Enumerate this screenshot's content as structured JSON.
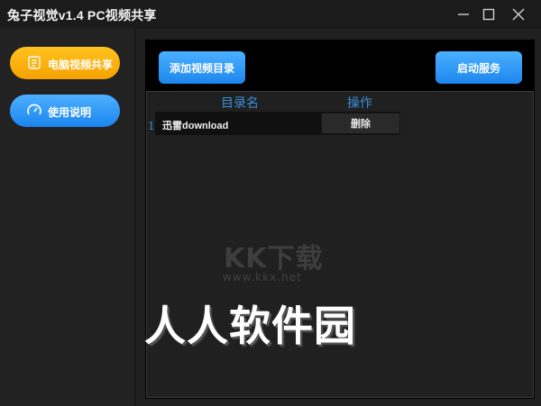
{
  "window": {
    "title": "兔子视觉v1.4 PC视频共享",
    "controls": {
      "minimize": "minimize-icon",
      "maximize": "maximize-icon",
      "close": "close-icon"
    }
  },
  "sidebar": {
    "items": [
      {
        "label": "电脑视频共享",
        "icon": "video-share-icon",
        "color": "#f5a800"
      },
      {
        "label": "使用说明",
        "icon": "help-gauge-icon",
        "color": "#2a95f8"
      }
    ]
  },
  "toolbar": {
    "add_label": "添加视频目录",
    "start_label": "启动服务"
  },
  "table": {
    "headers": {
      "name": "目录名",
      "action": "操作"
    },
    "rows": [
      {
        "index": "1",
        "name": "迅雷download",
        "action": "删除"
      }
    ]
  },
  "watermarks": {
    "kk_logo": "KK下载",
    "kk_url": "www.kkx.net",
    "site": "人人软件园"
  }
}
